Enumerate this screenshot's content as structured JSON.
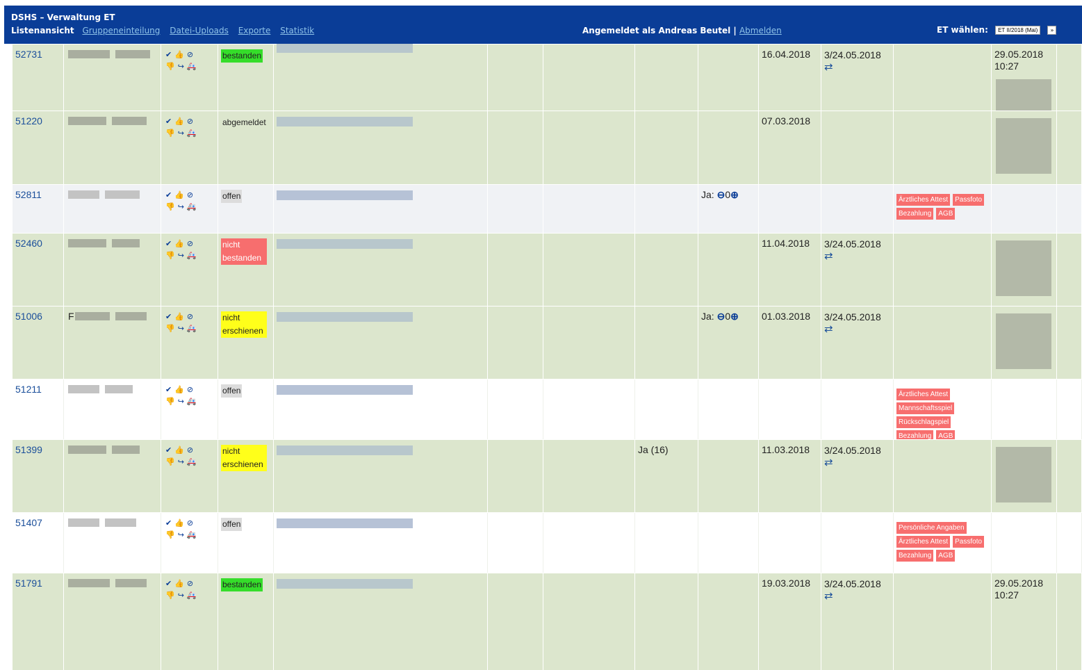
{
  "header": {
    "app_title": "DSHS – Verwaltung ET",
    "current_view": "Listenansicht",
    "nav_links": [
      "Gruppeneinteilung",
      "Datei-Uploads",
      "Exporte",
      "Statistik"
    ],
    "logged_in_text": "Angemeldet als Andreas Beutel |",
    "logout_label": "Abmelden",
    "et_label": "ET wählen:",
    "et_selected": "ET II/2018 (Mai)",
    "et_go": "»"
  },
  "icons": {
    "row_actions": [
      "check-circle-icon",
      "thumbs-up-icon",
      "ban-icon",
      "thumbs-down-icon",
      "sign-out-icon",
      "ambulance-icon"
    ],
    "swap": "exchange-icon",
    "minus": "minus-circle-icon",
    "plus": "plus-circle-icon"
  },
  "colors": {
    "header_bg": "#0a3d97",
    "row_green": "#dce6cd",
    "status_green": "#35dd2a",
    "status_red": "#f76e6e",
    "status_yellow": "#ffff1a",
    "missing_tag": "#f76e6e"
  },
  "rows": [
    {
      "id": "52731",
      "status": "bestanden",
      "count": "",
      "reg_date": "16.04.2018",
      "exam": "3/24.05.2018",
      "missing": [],
      "upload": "29.05.2018 10:27"
    },
    {
      "id": "51220",
      "status": "abgemeldet",
      "count": "",
      "reg_date": "07.03.2018",
      "exam": "",
      "missing": [],
      "upload": ""
    },
    {
      "id": "52811",
      "status": "offen",
      "count": "Ja:",
      "count_value": "0",
      "reg_date": "",
      "exam": "",
      "missing": [
        "Ärztliches Attest",
        "Passfoto",
        "Bezahlung",
        "AGB"
      ],
      "upload": ""
    },
    {
      "id": "52460",
      "status": "nicht bestanden",
      "count": "",
      "reg_date": "11.04.2018",
      "exam": "3/24.05.2018",
      "missing": [],
      "upload": ""
    },
    {
      "id": "51006",
      "name_initial": "F",
      "status": "nicht erschienen",
      "count": "Ja:",
      "count_value": "0",
      "reg_date": "01.03.2018",
      "exam": "3/24.05.2018",
      "missing": [],
      "upload": ""
    },
    {
      "id": "51211",
      "status": "offen",
      "count": "",
      "reg_date": "",
      "exam": "",
      "missing": [
        "Ärztliches Attest",
        "Mannschaftsspiel",
        "Rückschlagspiel",
        "Bezahlung",
        "AGB"
      ],
      "upload": ""
    },
    {
      "id": "51399",
      "status": "nicht erschienen",
      "extra": "Ja (16)",
      "count": "",
      "reg_date": "11.03.2018",
      "exam": "3/24.05.2018",
      "missing": [],
      "upload": ""
    },
    {
      "id": "51407",
      "status": "offen",
      "count": "",
      "reg_date": "",
      "exam": "",
      "missing": [
        "Persönliche Angaben",
        "Ärztliches Attest",
        "Passfoto",
        "Bezahlung",
        "AGB"
      ],
      "upload": ""
    },
    {
      "id": "51791",
      "status": "bestanden",
      "count": "",
      "reg_date": "19.03.2018",
      "exam": "3/24.05.2018",
      "missing": [],
      "upload": "29.05.2018 10:27"
    }
  ]
}
